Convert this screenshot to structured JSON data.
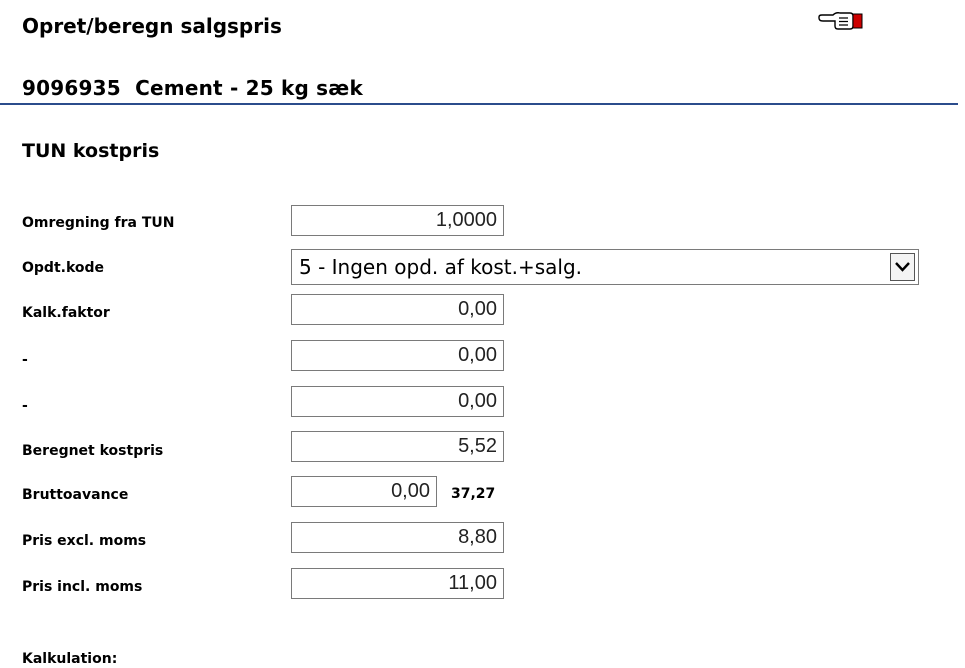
{
  "header": {
    "page_title": "Opret/beregn salgspris",
    "pointer_icon": "pointing-hand-icon"
  },
  "item": {
    "number": "9096935",
    "name": "Cement - 25 kg sæk"
  },
  "section": {
    "title": "TUN kostpris"
  },
  "fields": {
    "omregning": {
      "label": "Omregning fra TUN",
      "value": "1,0000"
    },
    "opdt_kode": {
      "label": "Opdt.kode",
      "value": "5 - Ingen opd. af kost.+salg."
    },
    "kalk_faktor": {
      "label": "Kalk.faktor",
      "value": "0,00"
    },
    "extra_1": {
      "label": "-",
      "value": "0,00"
    },
    "extra_2": {
      "label": "-",
      "value": "0,00"
    },
    "beregnet_kostpris": {
      "label": "Beregnet kostpris",
      "value": "5,52"
    },
    "bruttoavance": {
      "label": "Bruttoavance",
      "value": "0,00",
      "computed": "37,27"
    },
    "pris_excl_moms": {
      "label": "Pris excl. moms",
      "value": "8,80"
    },
    "pris_incl_moms": {
      "label": "Pris incl. moms",
      "value": "11,00"
    }
  },
  "footer": {
    "kalkulation_label": "Kalkulation:"
  },
  "colors": {
    "rule": "#2b4c8c",
    "pointer_cuff": "#cc0000"
  }
}
